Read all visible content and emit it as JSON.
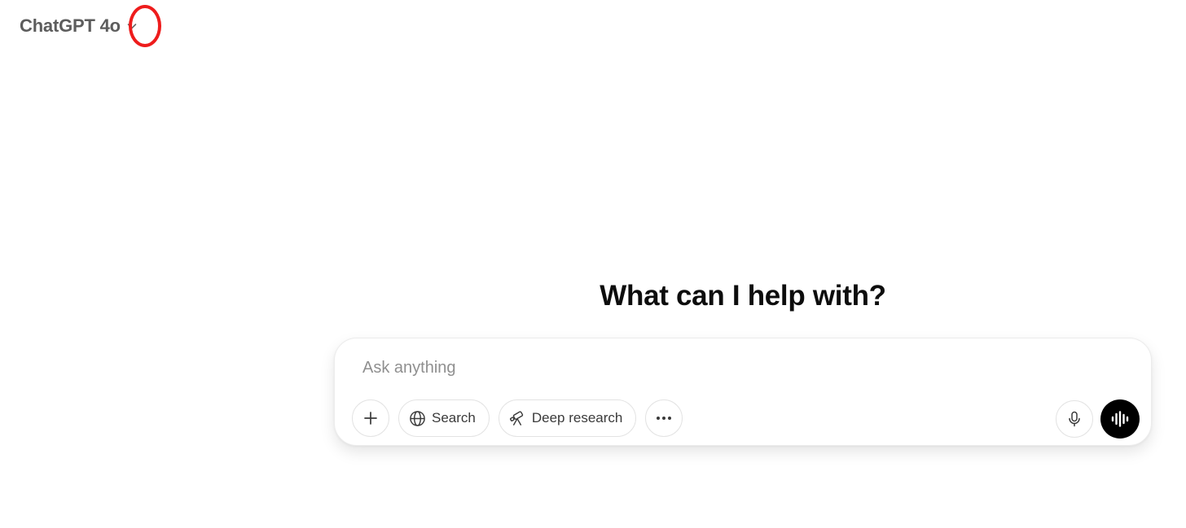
{
  "header": {
    "model_name": "ChatGPT 4o"
  },
  "main": {
    "heading": "What can I help with?"
  },
  "composer": {
    "placeholder": "Ask anything",
    "value": "",
    "tools": {
      "search_label": "Search",
      "deep_research_label": "Deep research"
    }
  },
  "icons": {
    "chevron": "chevron-down-icon",
    "plus": "plus-icon",
    "search": "globe-icon",
    "deep_research": "telescope-icon",
    "more": "ellipsis-icon",
    "mic": "microphone-icon",
    "voice": "voice-waveform-icon"
  },
  "colors": {
    "highlight_ring": "#ee1c1c",
    "voice_button": "#000000",
    "text_primary": "#0d0d0d",
    "text_muted": "#5d5d5d",
    "placeholder": "#8f8f8f"
  }
}
